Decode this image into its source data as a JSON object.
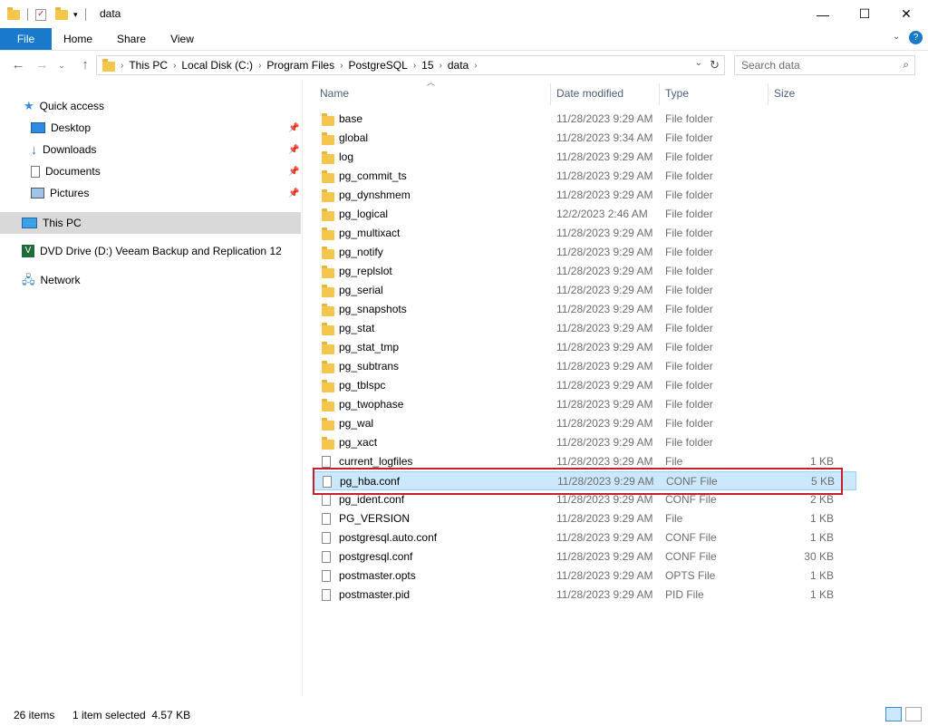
{
  "window": {
    "title": "data"
  },
  "ribbon": {
    "tabs": [
      "File",
      "Home",
      "Share",
      "View"
    ]
  },
  "address": {
    "crumbs": [
      "This PC",
      "Local Disk (C:)",
      "Program Files",
      "PostgreSQL",
      "15",
      "data"
    ],
    "search_placeholder": "Search data"
  },
  "sidebar": {
    "quick_access": "Quick access",
    "pinned": [
      "Desktop",
      "Downloads",
      "Documents",
      "Pictures"
    ],
    "this_pc": "This PC",
    "dvd": "DVD Drive (D:) Veeam Backup and Replication 12",
    "network": "Network"
  },
  "columns": {
    "name": "Name",
    "date": "Date modified",
    "type": "Type",
    "size": "Size"
  },
  "files": [
    {
      "name": "base",
      "date": "11/28/2023 9:29 AM",
      "type": "File folder",
      "size": "",
      "folder": true
    },
    {
      "name": "global",
      "date": "11/28/2023 9:34 AM",
      "type": "File folder",
      "size": "",
      "folder": true
    },
    {
      "name": "log",
      "date": "11/28/2023 9:29 AM",
      "type": "File folder",
      "size": "",
      "folder": true
    },
    {
      "name": "pg_commit_ts",
      "date": "11/28/2023 9:29 AM",
      "type": "File folder",
      "size": "",
      "folder": true
    },
    {
      "name": "pg_dynshmem",
      "date": "11/28/2023 9:29 AM",
      "type": "File folder",
      "size": "",
      "folder": true
    },
    {
      "name": "pg_logical",
      "date": "12/2/2023 2:46 AM",
      "type": "File folder",
      "size": "",
      "folder": true
    },
    {
      "name": "pg_multixact",
      "date": "11/28/2023 9:29 AM",
      "type": "File folder",
      "size": "",
      "folder": true
    },
    {
      "name": "pg_notify",
      "date": "11/28/2023 9:29 AM",
      "type": "File folder",
      "size": "",
      "folder": true
    },
    {
      "name": "pg_replslot",
      "date": "11/28/2023 9:29 AM",
      "type": "File folder",
      "size": "",
      "folder": true
    },
    {
      "name": "pg_serial",
      "date": "11/28/2023 9:29 AM",
      "type": "File folder",
      "size": "",
      "folder": true
    },
    {
      "name": "pg_snapshots",
      "date": "11/28/2023 9:29 AM",
      "type": "File folder",
      "size": "",
      "folder": true
    },
    {
      "name": "pg_stat",
      "date": "11/28/2023 9:29 AM",
      "type": "File folder",
      "size": "",
      "folder": true
    },
    {
      "name": "pg_stat_tmp",
      "date": "11/28/2023 9:29 AM",
      "type": "File folder",
      "size": "",
      "folder": true
    },
    {
      "name": "pg_subtrans",
      "date": "11/28/2023 9:29 AM",
      "type": "File folder",
      "size": "",
      "folder": true
    },
    {
      "name": "pg_tblspc",
      "date": "11/28/2023 9:29 AM",
      "type": "File folder",
      "size": "",
      "folder": true
    },
    {
      "name": "pg_twophase",
      "date": "11/28/2023 9:29 AM",
      "type": "File folder",
      "size": "",
      "folder": true
    },
    {
      "name": "pg_wal",
      "date": "11/28/2023 9:29 AM",
      "type": "File folder",
      "size": "",
      "folder": true
    },
    {
      "name": "pg_xact",
      "date": "11/28/2023 9:29 AM",
      "type": "File folder",
      "size": "",
      "folder": true
    },
    {
      "name": "current_logfiles",
      "date": "11/28/2023 9:29 AM",
      "type": "File",
      "size": "1 KB",
      "folder": false
    },
    {
      "name": "pg_hba.conf",
      "date": "11/28/2023 9:29 AM",
      "type": "CONF File",
      "size": "5 KB",
      "folder": false,
      "selected": true
    },
    {
      "name": "pg_ident.conf",
      "date": "11/28/2023 9:29 AM",
      "type": "CONF File",
      "size": "2 KB",
      "folder": false
    },
    {
      "name": "PG_VERSION",
      "date": "11/28/2023 9:29 AM",
      "type": "File",
      "size": "1 KB",
      "folder": false
    },
    {
      "name": "postgresql.auto.conf",
      "date": "11/28/2023 9:29 AM",
      "type": "CONF File",
      "size": "1 KB",
      "folder": false
    },
    {
      "name": "postgresql.conf",
      "date": "11/28/2023 9:29 AM",
      "type": "CONF File",
      "size": "30 KB",
      "folder": false
    },
    {
      "name": "postmaster.opts",
      "date": "11/28/2023 9:29 AM",
      "type": "OPTS File",
      "size": "1 KB",
      "folder": false
    },
    {
      "name": "postmaster.pid",
      "date": "11/28/2023 9:29 AM",
      "type": "PID File",
      "size": "1 KB",
      "folder": false
    }
  ],
  "status": {
    "count": "26 items",
    "selection": "1 item selected  4.57 KB"
  },
  "colors": {
    "accent": "#1979ca",
    "selection": "#cce8ff",
    "highlight": "#c8202a",
    "folder": "#f4c64c"
  }
}
